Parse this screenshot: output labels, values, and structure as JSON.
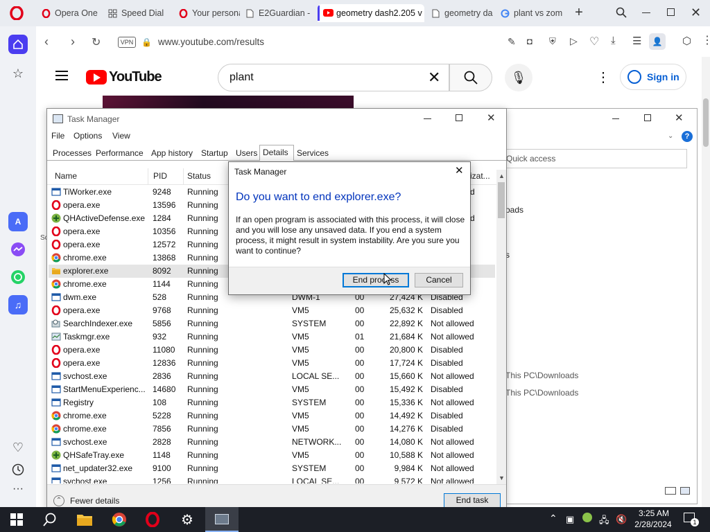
{
  "browser": {
    "tabs": [
      {
        "label": "Opera One",
        "icon": "opera-icon"
      },
      {
        "label": "Speed Dial",
        "icon": "speed-dial-icon"
      },
      {
        "label": "Your persona",
        "icon": "opera-icon"
      },
      {
        "label": "E2Guardian -",
        "icon": "document-icon"
      },
      {
        "label": "geometry dash2.205 v",
        "icon": "youtube-icon"
      },
      {
        "label": "geometry da",
        "icon": "document-icon"
      },
      {
        "label": "plant vs zom",
        "icon": "google-icon"
      }
    ],
    "vpn_label": "VPN",
    "url": "www.youtube.com/results"
  },
  "youtube": {
    "logo_text": "YouTube",
    "search_value": "plant",
    "signin_label": "Sign in"
  },
  "bg_window": {
    "quick_access": "Quick access",
    "frag_loads": "oads",
    "frag_s": "s",
    "path1": "This PC\\Downloads",
    "path2": "This PC\\Downloads"
  },
  "task_manager": {
    "title": "Task Manager",
    "menu": [
      "File",
      "Options",
      "View"
    ],
    "tabs": [
      "Processes",
      "Performance",
      "App history",
      "Startup",
      "Users",
      "Details",
      "Services"
    ],
    "selected_tab": "Details",
    "columns": {
      "name": "Name",
      "pid": "PID",
      "status": "Status",
      "tail": "izat..."
    },
    "processes": [
      {
        "name": "TiWorker.exe",
        "pid": "9248",
        "status": "Running",
        "user": "",
        "cpu": "",
        "mem": "",
        "virt": "",
        "icon": "service-icon",
        "tail": "d"
      },
      {
        "name": "opera.exe",
        "pid": "13596",
        "status": "Running",
        "user": "",
        "cpu": "",
        "mem": "",
        "virt": "",
        "icon": "opera-icon",
        "tail": ""
      },
      {
        "name": "QHActiveDefense.exe",
        "pid": "1284",
        "status": "Running",
        "user": "",
        "cpu": "",
        "mem": "",
        "virt": "",
        "icon": "qh-icon",
        "tail": "d"
      },
      {
        "name": "opera.exe",
        "pid": "10356",
        "status": "Running",
        "user": "",
        "cpu": "",
        "mem": "",
        "virt": "",
        "icon": "opera-icon",
        "tail": ""
      },
      {
        "name": "opera.exe",
        "pid": "12572",
        "status": "Running",
        "user": "",
        "cpu": "",
        "mem": "",
        "virt": "",
        "icon": "opera-icon",
        "tail": ""
      },
      {
        "name": "chrome.exe",
        "pid": "13868",
        "status": "Running",
        "user": "",
        "cpu": "",
        "mem": "",
        "virt": "",
        "icon": "chrome-icon",
        "tail": ""
      },
      {
        "name": "explorer.exe",
        "pid": "8092",
        "status": "Running",
        "user": "",
        "cpu": "",
        "mem": "",
        "virt": "",
        "icon": "folder-icon",
        "tail": ""
      },
      {
        "name": "chrome.exe",
        "pid": "1144",
        "status": "Running",
        "user": "",
        "cpu": "",
        "mem": "",
        "virt": "",
        "icon": "chrome-icon",
        "tail": ""
      },
      {
        "name": "dwm.exe",
        "pid": "528",
        "status": "Running",
        "user": "DWM-1",
        "cpu": "00",
        "mem": "27,424 K",
        "virt": "Disabled",
        "icon": "service-icon",
        "tail": ""
      },
      {
        "name": "opera.exe",
        "pid": "9768",
        "status": "Running",
        "user": "VM5",
        "cpu": "00",
        "mem": "25,632 K",
        "virt": "Disabled",
        "icon": "opera-icon",
        "tail": ""
      },
      {
        "name": "SearchIndexer.exe",
        "pid": "5856",
        "status": "Running",
        "user": "SYSTEM",
        "cpu": "00",
        "mem": "22,892 K",
        "virt": "Not allowed",
        "icon": "search-indexer-icon",
        "tail": ""
      },
      {
        "name": "Taskmgr.exe",
        "pid": "932",
        "status": "Running",
        "user": "VM5",
        "cpu": "01",
        "mem": "21,684 K",
        "virt": "Not allowed",
        "icon": "taskmgr-icon",
        "tail": ""
      },
      {
        "name": "opera.exe",
        "pid": "11080",
        "status": "Running",
        "user": "VM5",
        "cpu": "00",
        "mem": "20,800 K",
        "virt": "Disabled",
        "icon": "opera-icon",
        "tail": ""
      },
      {
        "name": "opera.exe",
        "pid": "12836",
        "status": "Running",
        "user": "VM5",
        "cpu": "00",
        "mem": "17,724 K",
        "virt": "Disabled",
        "icon": "opera-icon",
        "tail": ""
      },
      {
        "name": "svchost.exe",
        "pid": "2836",
        "status": "Running",
        "user": "LOCAL SE...",
        "cpu": "00",
        "mem": "15,660 K",
        "virt": "Not allowed",
        "icon": "service-icon",
        "tail": ""
      },
      {
        "name": "StartMenuExperienc...",
        "pid": "14680",
        "status": "Running",
        "user": "VM5",
        "cpu": "00",
        "mem": "15,492 K",
        "virt": "Disabled",
        "icon": "service-icon",
        "tail": ""
      },
      {
        "name": "Registry",
        "pid": "108",
        "status": "Running",
        "user": "SYSTEM",
        "cpu": "00",
        "mem": "15,336 K",
        "virt": "Not allowed",
        "icon": "service-icon",
        "tail": ""
      },
      {
        "name": "chrome.exe",
        "pid": "5228",
        "status": "Running",
        "user": "VM5",
        "cpu": "00",
        "mem": "14,492 K",
        "virt": "Disabled",
        "icon": "chrome-icon",
        "tail": ""
      },
      {
        "name": "chrome.exe",
        "pid": "7856",
        "status": "Running",
        "user": "VM5",
        "cpu": "00",
        "mem": "14,276 K",
        "virt": "Disabled",
        "icon": "chrome-icon",
        "tail": ""
      },
      {
        "name": "svchost.exe",
        "pid": "2828",
        "status": "Running",
        "user": "NETWORK...",
        "cpu": "00",
        "mem": "14,080 K",
        "virt": "Not allowed",
        "icon": "service-icon",
        "tail": ""
      },
      {
        "name": "QHSafeTray.exe",
        "pid": "1148",
        "status": "Running",
        "user": "VM5",
        "cpu": "00",
        "mem": "10,588 K",
        "virt": "Not allowed",
        "icon": "qh-icon",
        "tail": ""
      },
      {
        "name": "net_updater32.exe",
        "pid": "9100",
        "status": "Running",
        "user": "SYSTEM",
        "cpu": "00",
        "mem": "9,984 K",
        "virt": "Not allowed",
        "icon": "service-icon",
        "tail": ""
      },
      {
        "name": "svchost.exe",
        "pid": "1256",
        "status": "Running",
        "user": "LOCAL SE...",
        "cpu": "00",
        "mem": "9,572 K",
        "virt": "Not allowed",
        "icon": "service-icon",
        "tail": ""
      }
    ],
    "selected_process": "explorer.exe",
    "fewer_details": "Fewer details",
    "end_task": "End task"
  },
  "dialog": {
    "title": "Task Manager",
    "heading": "Do you want to end explorer.exe?",
    "body": "If an open program is associated with this process, it will close and you will lose any unsaved data. If you end a system process, it might result in system instability. Are you sure you want to continue?",
    "end_process": "End process",
    "cancel": "Cancel"
  },
  "taskbar": {
    "time": "3:25 AM",
    "date": "2/28/2024",
    "notifications": "1"
  },
  "colors": {
    "opera_red": "#e2001a",
    "youtube_red": "#ff0000",
    "link_blue": "#065fd4",
    "dialog_heading": "#0033bc",
    "taskbar": "#1c1f26"
  }
}
